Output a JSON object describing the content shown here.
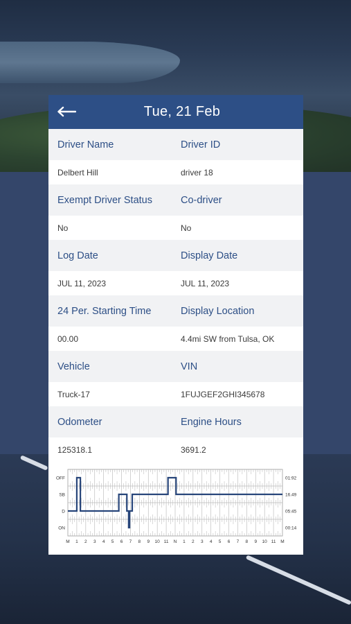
{
  "header": {
    "title": "Tue, 21  Feb"
  },
  "fields": [
    {
      "left_label": "Driver Name",
      "right_label": "Driver ID",
      "left_value": "Delbert Hill",
      "right_value": "driver 18"
    },
    {
      "left_label": "Exempt Driver Status",
      "right_label": "Co-driver",
      "left_value": "No",
      "right_value": "No"
    },
    {
      "left_label": "Log Date",
      "right_label": "Display Date",
      "left_value": "JUL 11, 2023",
      "right_value": "JUL 11, 2023"
    },
    {
      "left_label": "24 Per. Starting Time",
      "right_label": "Display Location",
      "left_value": "00.00",
      "right_value": "4.4mi SW from Tulsa, OK"
    },
    {
      "left_label": "Vehicle",
      "right_label": "VIN",
      "left_value": "Truck-17",
      "right_value": "1FUJGEF2GHI345678"
    },
    {
      "left_label": "Odometer",
      "right_label": "Engine Hours",
      "left_value": "125318.1",
      "right_value": "3691.2"
    }
  ],
  "chart_data": {
    "type": "line",
    "statuses": [
      "OFF",
      "SB",
      "D",
      "ON"
    ],
    "totals": [
      "01:92",
      "16.49",
      "05:45",
      "00:14"
    ],
    "x_labels": [
      "M",
      "1",
      "2",
      "3",
      "4",
      "5",
      "6",
      "7",
      "8",
      "9",
      "10",
      "11",
      "N",
      "1",
      "2",
      "3",
      "4",
      "5",
      "6",
      "7",
      "8",
      "9",
      "10",
      "11",
      "M"
    ],
    "steps": [
      {
        "x": 0,
        "status": "D"
      },
      {
        "x": 1.0,
        "status": "OFF"
      },
      {
        "x": 1.4,
        "status": "D"
      },
      {
        "x": 5.7,
        "status": "SB"
      },
      {
        "x": 6.6,
        "status": "D"
      },
      {
        "x": 6.8,
        "status": "ON"
      },
      {
        "x": 6.9,
        "status": "D"
      },
      {
        "x": 7.2,
        "status": "SB"
      },
      {
        "x": 11.2,
        "status": "OFF"
      },
      {
        "x": 12.1,
        "status": "SB"
      },
      {
        "x": 24,
        "status": "SB"
      }
    ]
  },
  "colors": {
    "header_bg": "#2d4f86",
    "label_text": "#2d4f86",
    "line": "#27457a"
  },
  "icons": {
    "back": "left-arrow-icon"
  }
}
